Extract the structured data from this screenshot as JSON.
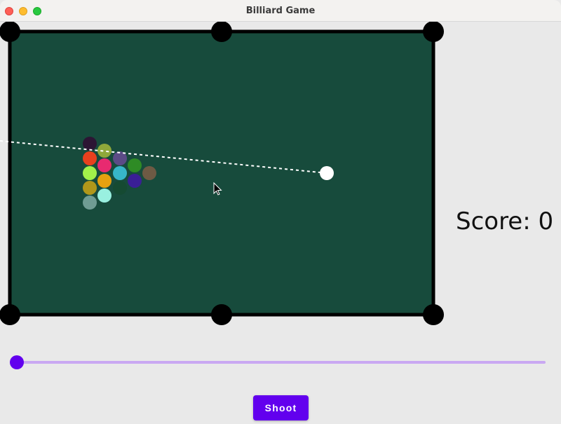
{
  "window": {
    "title": "Billiard Game"
  },
  "colors": {
    "felt": "#174b3c",
    "rail": "#000000",
    "pocket": "#000000",
    "cue_ball": "#ffffff",
    "aim_line": "#ffffff",
    "accent": "#6200ee",
    "slider_track": "#c9a8f2"
  },
  "table": {
    "pocket_count": 6,
    "balls": [
      {
        "color": "#2c1534"
      },
      {
        "color": "#8fa83a"
      },
      {
        "color": "#e8401e"
      },
      {
        "color": "#e82a70"
      },
      {
        "color": "#5b4b86"
      },
      {
        "color": "#a2f04a"
      },
      {
        "color": "#37b6c9"
      },
      {
        "color": "#2e8b25"
      },
      {
        "color": "#6e5a44"
      },
      {
        "color": "#b0971a"
      },
      {
        "color": "#e6a10f"
      },
      {
        "color": "#154a32"
      },
      {
        "color": "#3a1f96"
      },
      {
        "color": "#6f9c93"
      },
      {
        "color": "#99f0e0"
      }
    ],
    "cue_ball_icon": "white-circle",
    "cursor_icon": "arrow-cursor"
  },
  "score": {
    "text": "Score: 0"
  },
  "power_slider": {
    "value": 0
  },
  "shoot_button": {
    "label": "Shoot"
  }
}
